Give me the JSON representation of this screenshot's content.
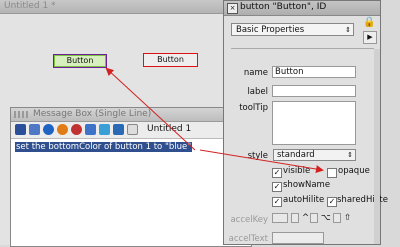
{
  "card_window": {
    "title": "Untitled 1 *",
    "button1_label": "Button",
    "button2_label": "Button"
  },
  "message_box": {
    "title": "Message Box (Single Line)",
    "stack_label": "Untitled 1",
    "command_text": "set the bottomColor of button 1 to \"blue\""
  },
  "inspector": {
    "title": "button \"Button\", ID",
    "section": "Basic Properties",
    "name_label": "name",
    "name_value": "Button",
    "label_label": "label",
    "label_value": "",
    "tooltip_label": "toolTip",
    "style_label": "style",
    "style_value": "standard",
    "visible_label": "visible",
    "opaque_label": "opaque",
    "showname_label": "showName",
    "autohilite_label": "autoHilite",
    "sharedhilite_label": "sharedHilite",
    "accelkey_label": "accelKey",
    "acceltext_label": "accelText",
    "accel_key_glyphs": [
      "^",
      "⌥",
      "⇧"
    ]
  },
  "colors": {
    "arrow": "#d22222",
    "selection": "#2f4f8f"
  }
}
